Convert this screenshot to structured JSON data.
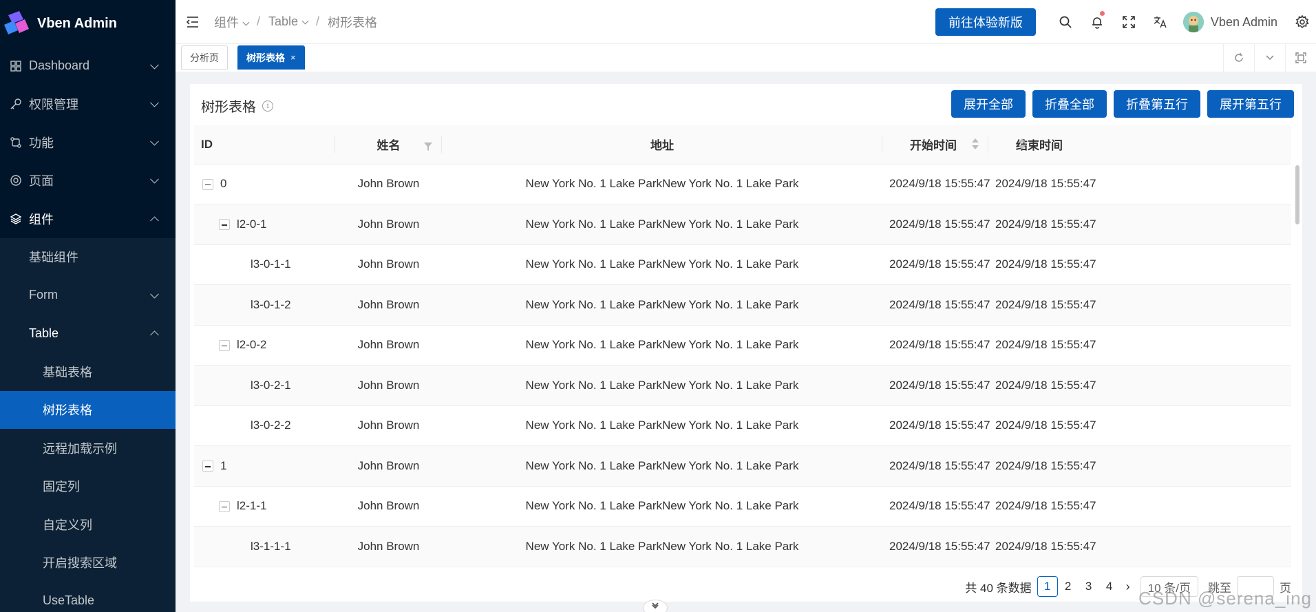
{
  "app": {
    "title": "Vben Admin"
  },
  "sidebar": {
    "items": [
      {
        "label": "Dashboard",
        "icon": "dashboard-icon"
      },
      {
        "label": "权限管理",
        "icon": "key-icon"
      },
      {
        "label": "功能",
        "icon": "function-icon"
      },
      {
        "label": "页面",
        "icon": "page-icon"
      },
      {
        "label": "组件",
        "icon": "layers-icon"
      }
    ],
    "components_children": [
      "基础组件",
      "Form",
      "Table"
    ],
    "table_children": [
      "基础表格",
      "树形表格",
      "远程加载示例",
      "固定列",
      "自定义列",
      "开启搜索区域",
      "UseTable"
    ]
  },
  "header": {
    "breadcrumb": [
      "组件",
      "Table",
      "树形表格"
    ],
    "try_button": "前往体验新版",
    "username": "Vben Admin"
  },
  "tabs": [
    {
      "label": "分析页",
      "active": false
    },
    {
      "label": "树形表格",
      "active": true,
      "close": "×"
    }
  ],
  "card": {
    "title": "树形表格",
    "actions": [
      "展开全部",
      "折叠全部",
      "折叠第五行",
      "展开第五行"
    ],
    "columns": [
      "ID",
      "姓名",
      "地址",
      "开始时间",
      "结束时间"
    ],
    "rows": [
      {
        "id": "0",
        "level": 0,
        "expander": true,
        "name": "John Brown",
        "address": "New York No. 1 Lake ParkNew York No. 1 Lake Park",
        "start": "2024/9/18 15:55:47",
        "end": "2024/9/18 15:55:47"
      },
      {
        "id": "l2-0-1",
        "level": 1,
        "expander": true,
        "name": "John Brown",
        "address": "New York No. 1 Lake ParkNew York No. 1 Lake Park",
        "start": "2024/9/18 15:55:47",
        "end": "2024/9/18 15:55:47"
      },
      {
        "id": "l3-0-1-1",
        "level": 2,
        "expander": false,
        "name": "John Brown",
        "address": "New York No. 1 Lake ParkNew York No. 1 Lake Park",
        "start": "2024/9/18 15:55:47",
        "end": "2024/9/18 15:55:47"
      },
      {
        "id": "l3-0-1-2",
        "level": 2,
        "expander": false,
        "name": "John Brown",
        "address": "New York No. 1 Lake ParkNew York No. 1 Lake Park",
        "start": "2024/9/18 15:55:47",
        "end": "2024/9/18 15:55:47"
      },
      {
        "id": "l2-0-2",
        "level": 1,
        "expander": true,
        "name": "John Brown",
        "address": "New York No. 1 Lake ParkNew York No. 1 Lake Park",
        "start": "2024/9/18 15:55:47",
        "end": "2024/9/18 15:55:47"
      },
      {
        "id": "l3-0-2-1",
        "level": 2,
        "expander": false,
        "name": "John Brown",
        "address": "New York No. 1 Lake ParkNew York No. 1 Lake Park",
        "start": "2024/9/18 15:55:47",
        "end": "2024/9/18 15:55:47"
      },
      {
        "id": "l3-0-2-2",
        "level": 2,
        "expander": false,
        "name": "John Brown",
        "address": "New York No. 1 Lake ParkNew York No. 1 Lake Park",
        "start": "2024/9/18 15:55:47",
        "end": "2024/9/18 15:55:47"
      },
      {
        "id": "1",
        "level": 0,
        "expander": true,
        "name": "John Brown",
        "address": "New York No. 1 Lake ParkNew York No. 1 Lake Park",
        "start": "2024/9/18 15:55:47",
        "end": "2024/9/18 15:55:47"
      },
      {
        "id": "l2-1-1",
        "level": 1,
        "expander": true,
        "name": "John Brown",
        "address": "New York No. 1 Lake ParkNew York No. 1 Lake Park",
        "start": "2024/9/18 15:55:47",
        "end": "2024/9/18 15:55:47"
      },
      {
        "id": "l3-1-1-1",
        "level": 2,
        "expander": false,
        "name": "John Brown",
        "address": "New York No. 1 Lake ParkNew York No. 1 Lake Park",
        "start": "2024/9/18 15:55:47",
        "end": "2024/9/18 15:55:47"
      }
    ]
  },
  "pagination": {
    "total_text": "共 40 条数据",
    "pages": [
      "1",
      "2",
      "3",
      "4"
    ],
    "current": "1",
    "next": "›",
    "page_size": "10 条/页",
    "jump_prefix": "跳至",
    "jump_suffix": "页"
  },
  "watermark": "CSDN @serena_ing",
  "colors": {
    "primary": "#0960bd",
    "sidebar_bg": "#001529",
    "sub_bg": "#0c2135"
  }
}
